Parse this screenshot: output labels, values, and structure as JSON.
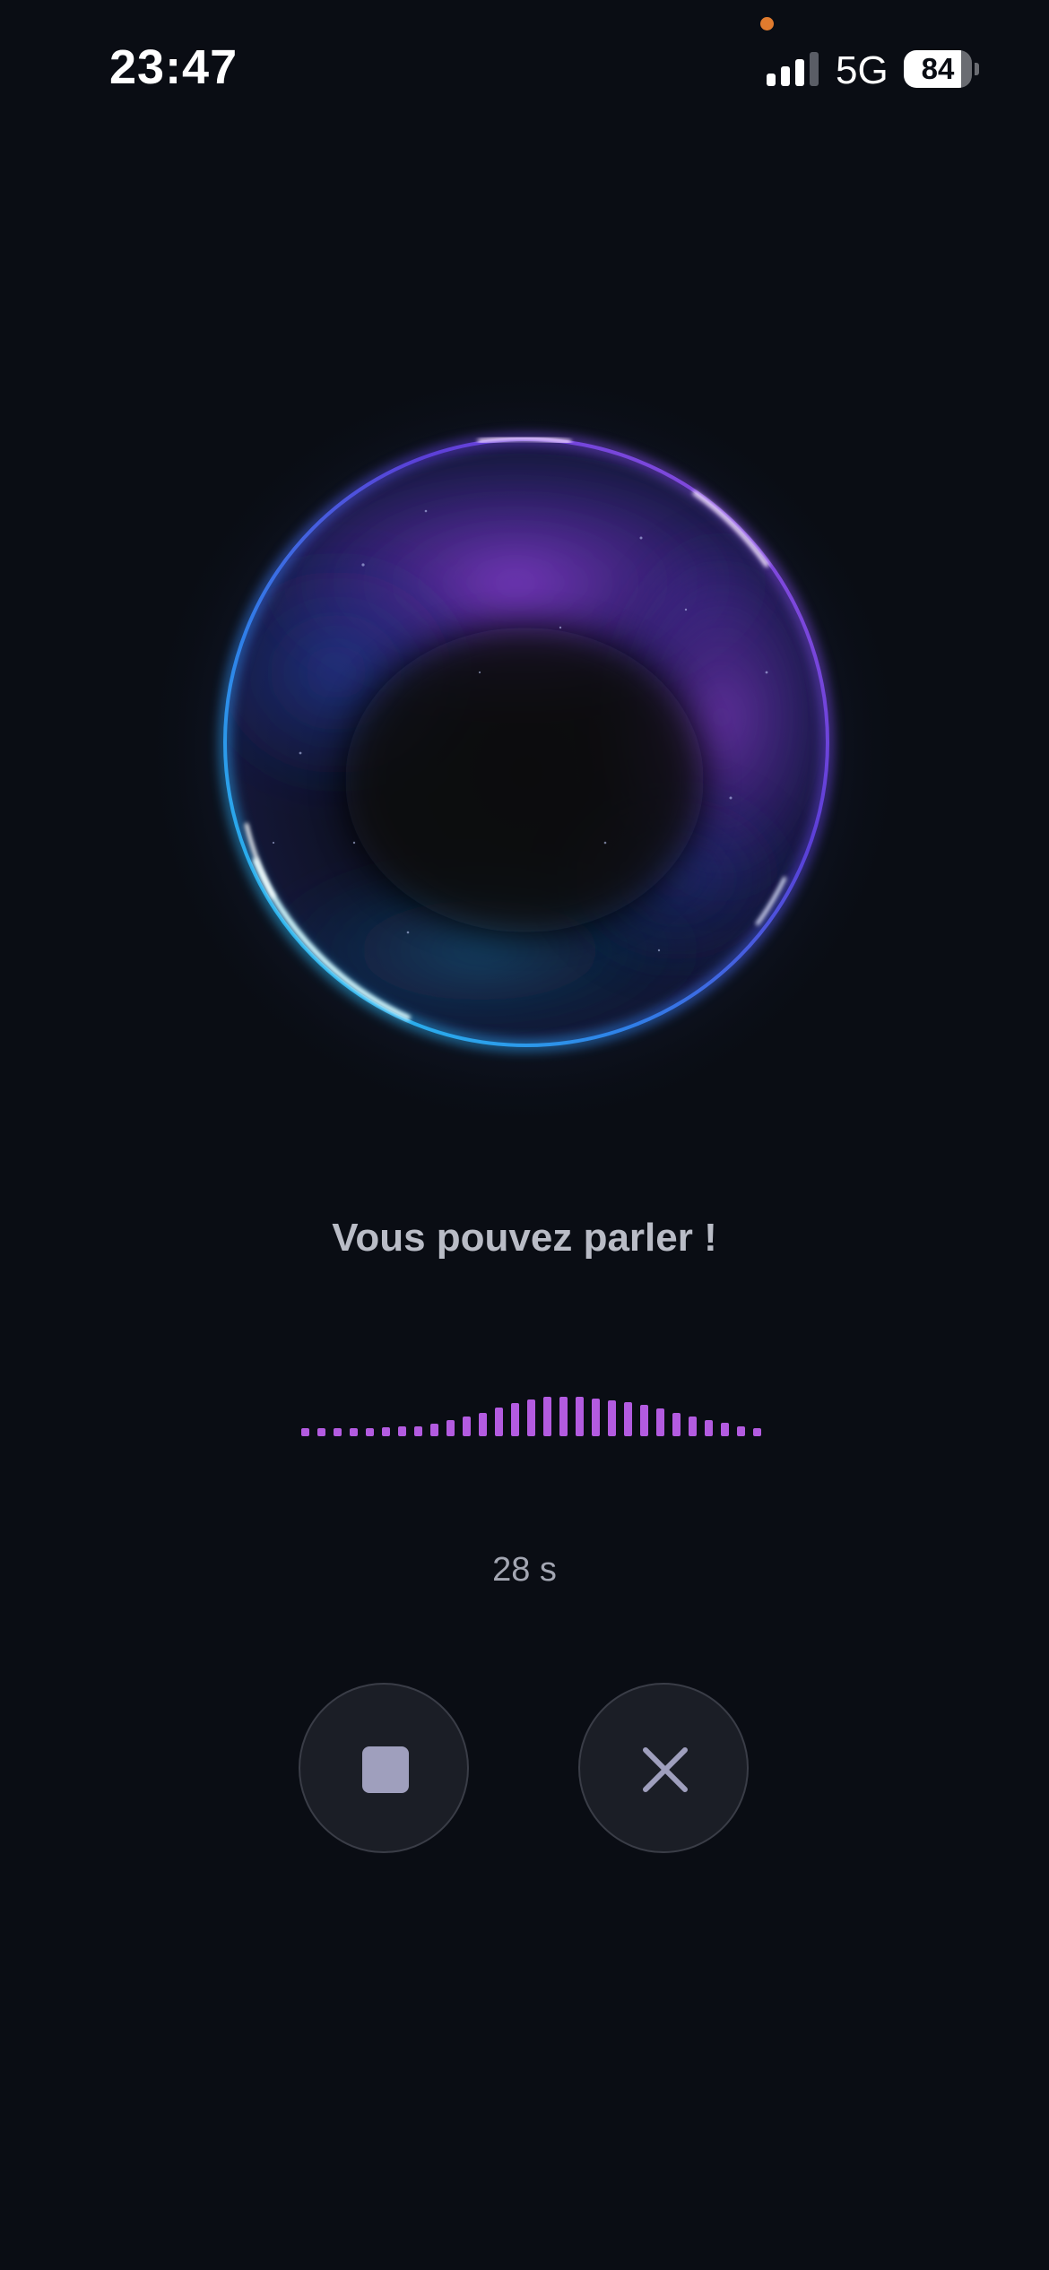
{
  "status_bar": {
    "time": "23:47",
    "network": "5G",
    "battery": "84",
    "signal_bars_active": 3,
    "signal_bars_total": 4,
    "privacy_indicator_color": "#e07b2e"
  },
  "orb": {
    "glow_colors": [
      "#7a3bd6",
      "#3b4fd6",
      "#1fb8e0"
    ]
  },
  "voice": {
    "prompt": "Vous pouvez parler !",
    "timer": "28 s",
    "waveform_levels": [
      0.2,
      0.2,
      0.2,
      0.2,
      0.2,
      0.22,
      0.24,
      0.26,
      0.32,
      0.4,
      0.5,
      0.6,
      0.72,
      0.84,
      0.94,
      1.0,
      1.0,
      1.0,
      0.96,
      0.92,
      0.86,
      0.8,
      0.7,
      0.6,
      0.5,
      0.42,
      0.34,
      0.26,
      0.2
    ],
    "waveform_color": "#b35be0"
  },
  "controls": {
    "stop_icon": "stop-icon",
    "cancel_icon": "close-icon"
  }
}
